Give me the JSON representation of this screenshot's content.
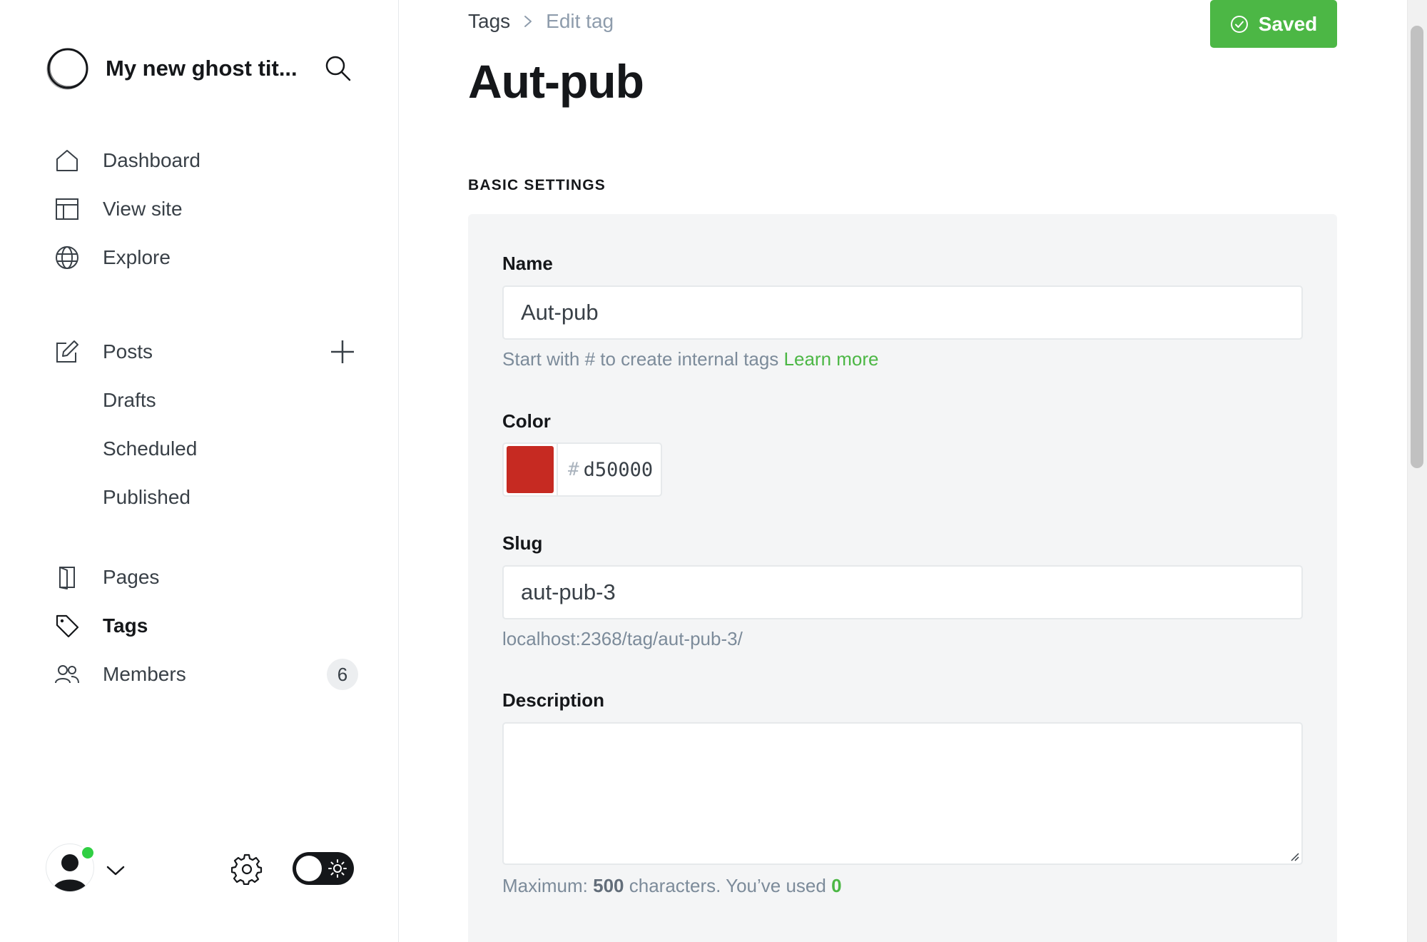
{
  "site": {
    "title": "My new ghost tit..."
  },
  "nav": {
    "dashboard": "Dashboard",
    "view_site": "View site",
    "explore": "Explore",
    "posts": "Posts",
    "drafts": "Drafts",
    "scheduled": "Scheduled",
    "published": "Published",
    "pages": "Pages",
    "tags": "Tags",
    "members": "Members",
    "members_count": "6"
  },
  "breadcrumb": {
    "parent": "Tags",
    "current": "Edit tag"
  },
  "header": {
    "saved_label": "Saved",
    "page_title": "Aut-pub"
  },
  "section": {
    "basic_settings": "BASIC SETTINGS"
  },
  "form": {
    "name_label": "Name",
    "name_value": "Aut-pub",
    "name_hint": "Start with # to create internal tags",
    "name_hint_link": "Learn more",
    "color_label": "Color",
    "color_hash": "#",
    "color_value": "d50000",
    "color_hex": "#c62a22",
    "slug_label": "Slug",
    "slug_value": "aut-pub-3",
    "slug_url": "localhost:2368/tag/aut-pub-3/",
    "description_label": "Description",
    "description_value": "",
    "desc_hint_prefix": "Maximum:",
    "desc_hint_max": "500",
    "desc_hint_mid": "characters. You’ve used",
    "desc_hint_used": "0"
  },
  "colors": {
    "accent_green": "#4cb745",
    "online": "#30cf43"
  }
}
